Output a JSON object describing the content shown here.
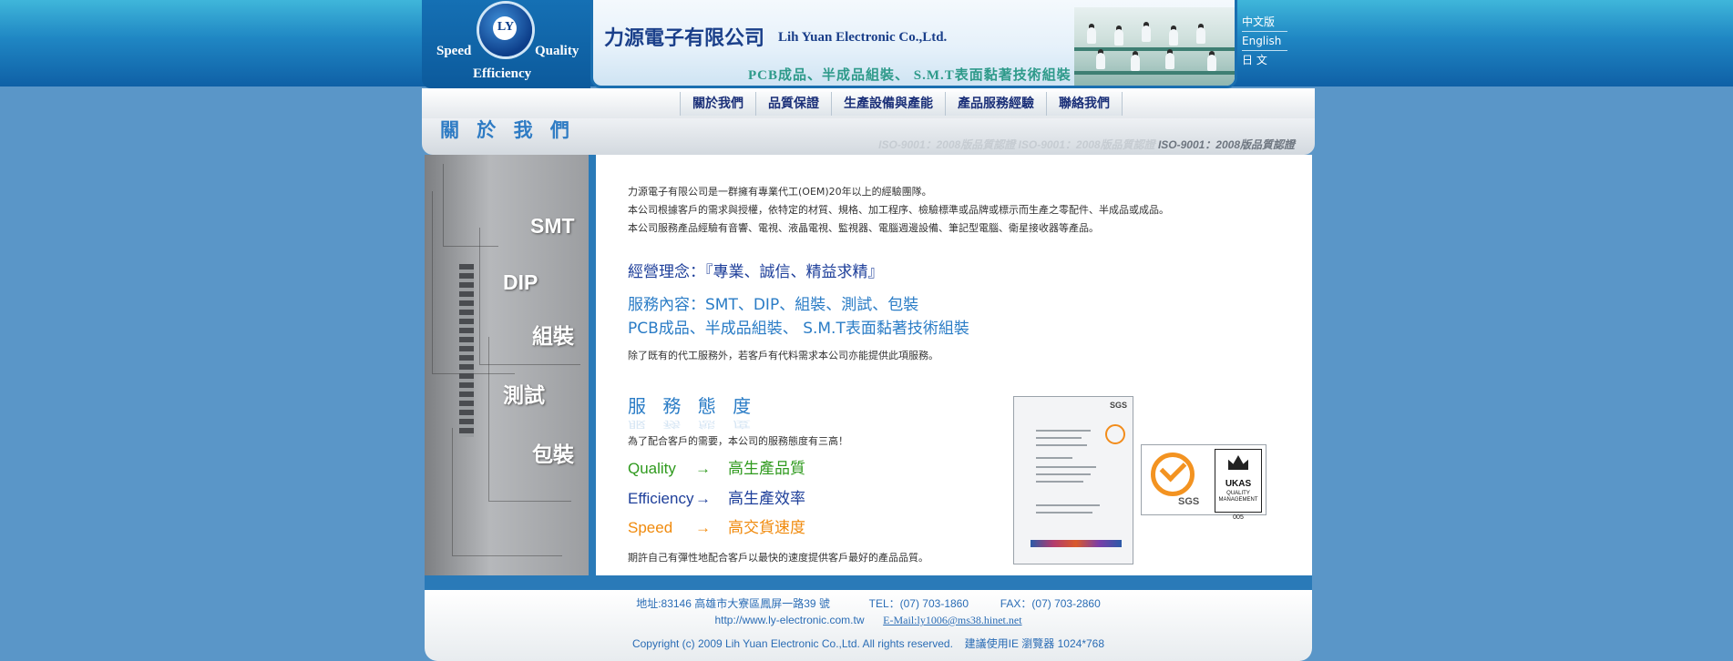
{
  "header": {
    "logo": {
      "mark": "LY",
      "words": [
        "Speed",
        "Quality",
        "Efficiency"
      ]
    },
    "company_zh": "力源電子有限公司",
    "company_en": "Lih Yuan Electronic Co.,Ltd.",
    "slogan": "PCB成品、半成品組裝、 S.M.T表面黏著技術組裝",
    "languages": [
      "中文版",
      "English",
      "日 文"
    ]
  },
  "nav": [
    "關於我們",
    "品質保證",
    "生產設備與產能",
    "產品服務經驗",
    "聯絡我們"
  ],
  "page_title": "關 於 我 們",
  "iso_banner": {
    "faded": "ISO-9001：2008版品質認證 ISO-9001：2008版品質認證",
    "strong": "ISO-9001：2008版品質認證"
  },
  "sidebar_words": [
    "SMT",
    "DIP",
    "組裝",
    "測試",
    "包裝"
  ],
  "intro": [
    "力源電子有限公司是一群擁有專業代工(OEM)20年以上的經驗團隊。",
    "本公司根據客戶的需求與授權，依特定的材質、規格、加工程序、檢驗標準或品牌或標示而生產之零配件、半成品或成品。",
    "本公司服務產品經驗有音響、電視、液晶電視、監視器、電腦週邊設備、筆記型電腦、衛星接收器等產品。"
  ],
  "philosophy": "經營理念：『專業、誠信、精益求精』",
  "services": [
    "服務內容：SMT、DIP、組裝、測試、包裝",
    "PCB成品、半成品組裝、 S.M.T表面黏著技術組裝"
  ],
  "extra_note": "除了既有的代工服務外，若客戶有代料需求本公司亦能提供此項服務。",
  "service_attitude": {
    "heading": "服 務 態 度",
    "intro": "為了配合客戶的需要，本公司的服務態度有三高！",
    "items": [
      {
        "key": "Quality",
        "arrow": "→",
        "value": "高生產品質",
        "color": "#2f9a1e"
      },
      {
        "key": "Efficiency",
        "arrow": "→",
        "value": "高生產效率",
        "color": "#1e3f9a"
      },
      {
        "key": "Speed",
        "arrow": "→",
        "value": "高交貨速度",
        "color": "#f08a0c"
      }
    ],
    "closing": "期許自己有彈性地配合客戶以最快的速度提供客戶最好的產品品質。"
  },
  "certificates": {
    "doc_header": "SGS",
    "sgs_mark": "SGS",
    "ukas_name": "UKAS",
    "ukas_sub": "QUALITY MANAGEMENT",
    "ukas_num": "005"
  },
  "footer": {
    "address": "地址:83146 高雄市大寮區鳳屏一路39 號",
    "tel": "TEL：(07) 703-1860",
    "fax": "FAX：(07) 703-2860",
    "website": "http://www.ly-electronic.com.tw",
    "email": "E-Mail:ly1006@ms38.hinet.net",
    "copyright": "Copyright (c) 2009 Lih Yuan Electronic Co.,Ltd. All rights reserved.",
    "browser_note": "建議使用IE 瀏覽器 1024*768"
  },
  "colors": {
    "page_bg": "#5a96c8",
    "brand_blue": "#1a6fb0",
    "quality": "#2f9a1e",
    "efficiency": "#1e3f9a",
    "speed": "#f08a0c",
    "head_blue": "#2a7cc6"
  }
}
